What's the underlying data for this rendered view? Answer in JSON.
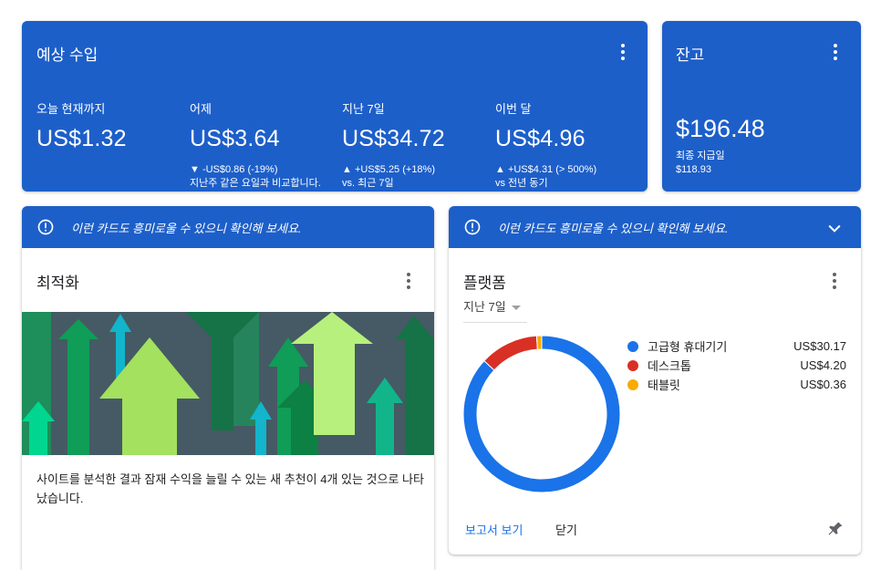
{
  "colors": {
    "card_blue": "#1d5fc9",
    "mobile": "#1a73e8",
    "desktop": "#d93025",
    "tablet": "#f9ab00",
    "link": "#1a73e8"
  },
  "earnings": {
    "title": "예상 수입",
    "menu_icon": "more-vert-icon",
    "metrics": [
      {
        "label": "오늘 현재까지",
        "value": "US$1.32",
        "change": "",
        "compare": ""
      },
      {
        "label": "어제",
        "value": "US$3.64",
        "change": "▼ -US$0.86 (-19%)",
        "compare": "지난주 같은 요일과 비교합니다."
      },
      {
        "label": "지난 7일",
        "value": "US$34.72",
        "change": "▲ +US$5.25 (+18%)",
        "compare": "vs. 최근 7일"
      },
      {
        "label": "이번 달",
        "value": "US$4.96",
        "change": "▲ +US$4.31 (> 500%)",
        "compare": "vs 전년 동기"
      }
    ]
  },
  "balance": {
    "title": "잔고",
    "amount": "$196.48",
    "last_payment_label": "최종 지급일",
    "last_payment_value": "$118.93"
  },
  "optimization": {
    "notice": "이런 카드도 흥미로울 수 있으니 확인해 보세요.",
    "title": "최적화",
    "description": "사이트를 분석한 결과 잠재 수익을 늘릴 수 있는 새 추천이 4개 있는 것으로 나타났습니다."
  },
  "platform": {
    "notice": "이런 카드도 흥미로울 수 있으니 확인해 보세요.",
    "title": "플랫폼",
    "period": "지난 7일",
    "chart_data": {
      "type": "pie",
      "categories": [
        "고급형 휴대기기",
        "데스크톱",
        "태블릿"
      ],
      "values": [
        30.17,
        4.2,
        0.36
      ],
      "labels": [
        "US$30.17",
        "US$4.20",
        "US$0.36"
      ]
    },
    "view_report": "보고서 보기",
    "close": "닫기"
  }
}
